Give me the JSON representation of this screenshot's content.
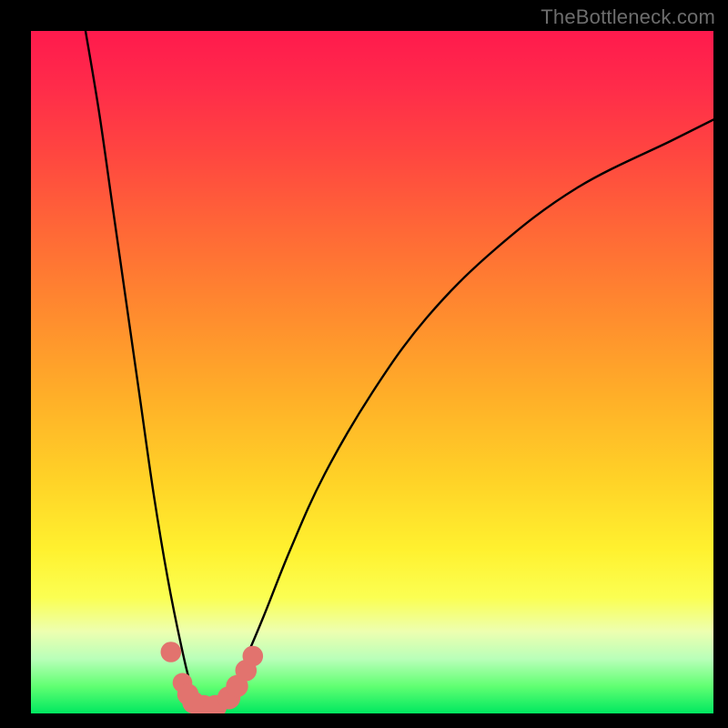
{
  "watermark": "TheBottleneck.com",
  "chart_data": {
    "type": "line",
    "title": "",
    "xlabel": "",
    "ylabel": "",
    "xlim": [
      0,
      100
    ],
    "ylim": [
      0,
      100
    ],
    "series": [
      {
        "name": "bottleneck-curve",
        "x": [
          8,
          10,
          12,
          14,
          16,
          18,
          20,
          22,
          23.5,
          25,
          27,
          29,
          31,
          34,
          38,
          43,
          50,
          58,
          68,
          80,
          94,
          100
        ],
        "y": [
          100,
          88,
          74,
          60,
          46,
          32,
          20,
          10,
          4,
          1,
          1,
          3,
          7,
          14,
          24,
          35,
          47,
          58,
          68,
          77,
          84,
          87
        ]
      }
    ],
    "markers": [
      {
        "x": 20.5,
        "y": 9.0,
        "r": 1.4
      },
      {
        "x": 22.2,
        "y": 4.5,
        "r": 1.3
      },
      {
        "x": 23.0,
        "y": 2.8,
        "r": 1.5
      },
      {
        "x": 23.8,
        "y": 1.6,
        "r": 1.6
      },
      {
        "x": 25.3,
        "y": 1.0,
        "r": 1.7
      },
      {
        "x": 27.0,
        "y": 1.0,
        "r": 1.7
      },
      {
        "x": 29.0,
        "y": 2.3,
        "r": 1.7
      },
      {
        "x": 30.2,
        "y": 4.0,
        "r": 1.6
      },
      {
        "x": 31.5,
        "y": 6.3,
        "r": 1.5
      },
      {
        "x": 32.5,
        "y": 8.4,
        "r": 1.4
      }
    ],
    "colors": {
      "curve": "#000000",
      "marker": "#e2736e",
      "gradient_top": "#ff1a4d",
      "gradient_bottom": "#00e860"
    }
  }
}
